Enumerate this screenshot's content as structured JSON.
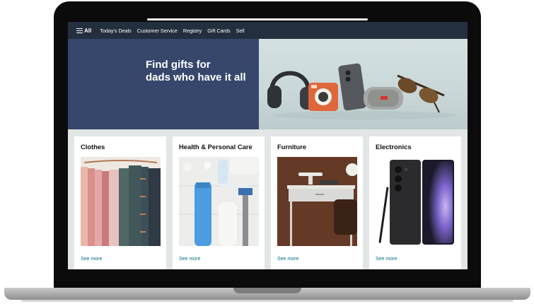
{
  "nav": {
    "all_label": "All",
    "links": [
      "Today's Deals",
      "Customer Service",
      "Registry",
      "Gift Cards",
      "Sell"
    ]
  },
  "hero": {
    "title_line1": "Find gifts for",
    "title_line2": "dads who have it all"
  },
  "cards": [
    {
      "title": "Clothes",
      "link": "See more",
      "image": "folded-pants-photo"
    },
    {
      "title": "Health & Personal Care",
      "link": "See more",
      "image": "toiletries-photo"
    },
    {
      "title": "Furniture",
      "link": "See more",
      "image": "desk-photo"
    },
    {
      "title": "Electronics",
      "link": "See more",
      "image": "smartphone-photo"
    }
  ],
  "colors": {
    "nav_bg": "#232f3e",
    "hero_left_bg": "#37476b",
    "page_bg": "#e3e6e6",
    "link": "#007185"
  }
}
